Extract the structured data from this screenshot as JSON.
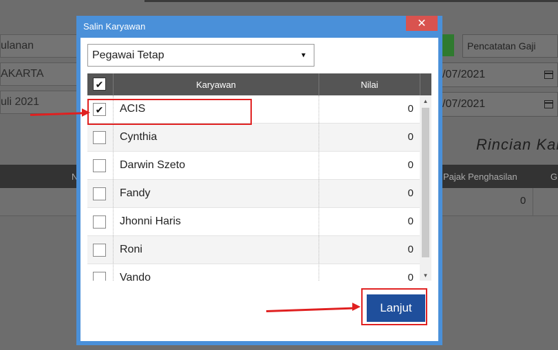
{
  "background": {
    "fields_left": [
      "ulanan",
      "AKARTA",
      "uli 2021"
    ],
    "select_label": "Pencatatan Gaji",
    "dates": [
      "/07/2021",
      "/07/2021"
    ],
    "heading": "Rincian Kary",
    "table_headers": [
      "N",
      "Pajak Penghasilan",
      "G"
    ],
    "row_value": "0"
  },
  "dialog": {
    "title": "Salin Karyawan",
    "close_glyph": "✕",
    "dropdown_value": "Pegawai Tetap",
    "dropdown_arrow": "▼",
    "columns": {
      "karyawan": "Karyawan",
      "nilai": "Nilai"
    },
    "header_check": "✔",
    "rows": [
      {
        "name": "ACIS",
        "value": "0",
        "checked": true,
        "check": "✔"
      },
      {
        "name": "Cynthia",
        "value": "0",
        "checked": false,
        "check": ""
      },
      {
        "name": "Darwin Szeto",
        "value": "0",
        "checked": false,
        "check": ""
      },
      {
        "name": "Fandy",
        "value": "0",
        "checked": false,
        "check": ""
      },
      {
        "name": "Jhonni Haris",
        "value": "0",
        "checked": false,
        "check": ""
      },
      {
        "name": "Roni",
        "value": "0",
        "checked": false,
        "check": ""
      },
      {
        "name": "Vando",
        "value": "0",
        "checked": false,
        "check": ""
      }
    ],
    "scroll_up": "▲",
    "scroll_down": "▼",
    "continue_label": "Lanjut"
  },
  "colors": {
    "dialog_frame": "#4a90d9",
    "close_button": "#d9534f",
    "grid_header": "#555555",
    "continue_button": "#1f4f9c",
    "annotation": "#e02020"
  }
}
